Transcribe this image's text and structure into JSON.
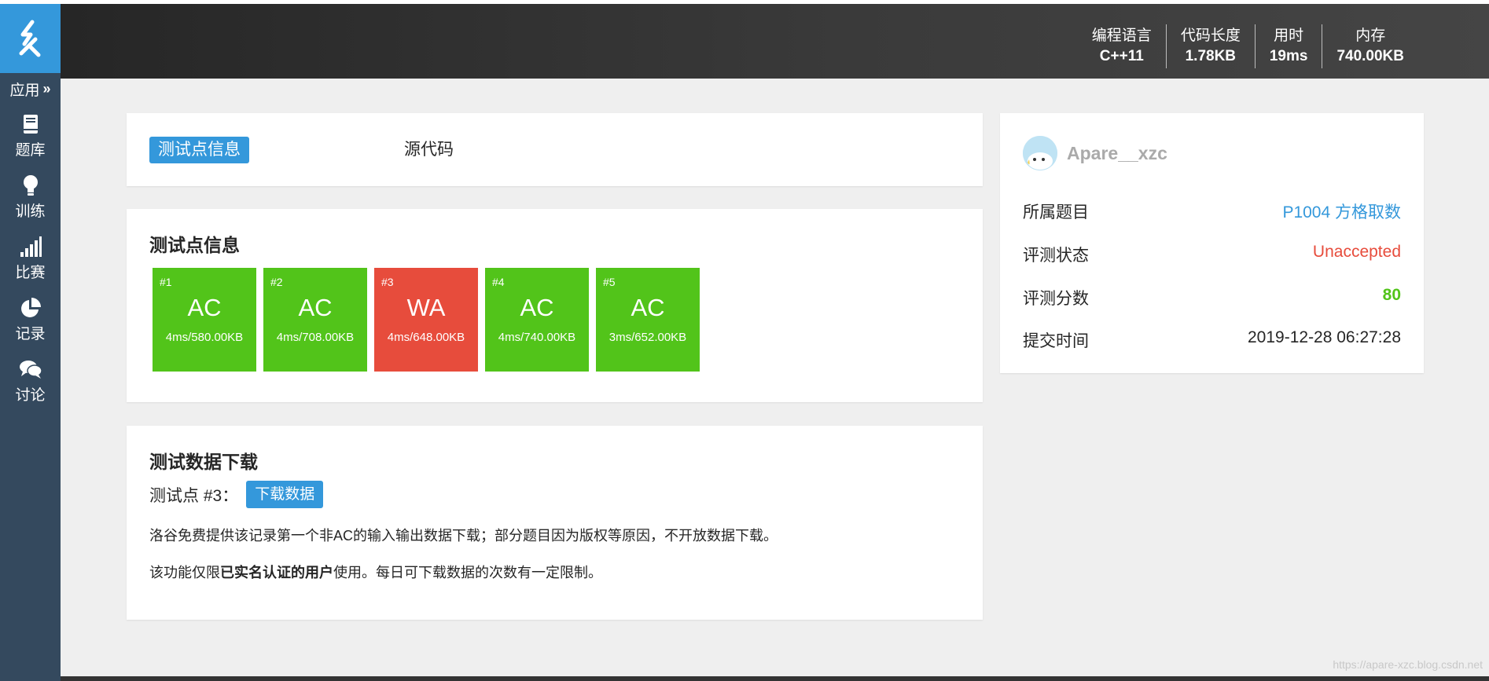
{
  "sidebar": {
    "apps_label": "应用",
    "items": [
      {
        "label": "题库",
        "icon": "book-icon"
      },
      {
        "label": "训练",
        "icon": "lightbulb-icon"
      },
      {
        "label": "比赛",
        "icon": "signal-bars-icon"
      },
      {
        "label": "记录",
        "icon": "pie-chart-icon"
      },
      {
        "label": "讨论",
        "icon": "chat-bubbles-icon"
      }
    ]
  },
  "header": {
    "stats": [
      {
        "key": "编程语言",
        "value": "C++11"
      },
      {
        "key": "代码长度",
        "value": "1.78KB"
      },
      {
        "key": "用时",
        "value": "19ms"
      },
      {
        "key": "内存",
        "value": "740.00KB"
      }
    ]
  },
  "tabs": {
    "active": "测试点信息",
    "other": "源代码"
  },
  "testcases": {
    "title": "测试点信息",
    "items": [
      {
        "id": "#1",
        "status": "AC",
        "stat": "4ms/580.00KB",
        "color": "#52c41a"
      },
      {
        "id": "#2",
        "status": "AC",
        "stat": "4ms/708.00KB",
        "color": "#52c41a"
      },
      {
        "id": "#3",
        "status": "WA",
        "stat": "4ms/648.00KB",
        "color": "#e74c3c"
      },
      {
        "id": "#4",
        "status": "AC",
        "stat": "4ms/740.00KB",
        "color": "#52c41a"
      },
      {
        "id": "#5",
        "status": "AC",
        "stat": "3ms/652.00KB",
        "color": "#52c41a"
      }
    ]
  },
  "download": {
    "title": "测试数据下载",
    "label": "测试点 #3：",
    "button": "下载数据",
    "note1": "洛谷免费提供该记录第一个非AC的输入输出数据下载；部分题目因为版权等原因，不开放数据下载。",
    "note2_pre": "该功能仅限",
    "note2_bold": "已实名认证的用户",
    "note2_post": "使用。每日可下载数据的次数有一定限制。"
  },
  "info": {
    "username": "Apare__xzc",
    "rows": [
      {
        "key": "所属题目",
        "value": "P1004 方格取数"
      },
      {
        "key": "评测状态",
        "value": "Unaccepted"
      },
      {
        "key": "评测分数",
        "value": "80"
      },
      {
        "key": "提交时间",
        "value": "2019-12-28 06:27:28"
      }
    ]
  },
  "watermark": "https://apare-xzc.blog.csdn.net",
  "colors": {
    "primary": "#3498db",
    "sidebar": "#34495e",
    "ac": "#52c41a",
    "wa": "#e74c3c"
  }
}
